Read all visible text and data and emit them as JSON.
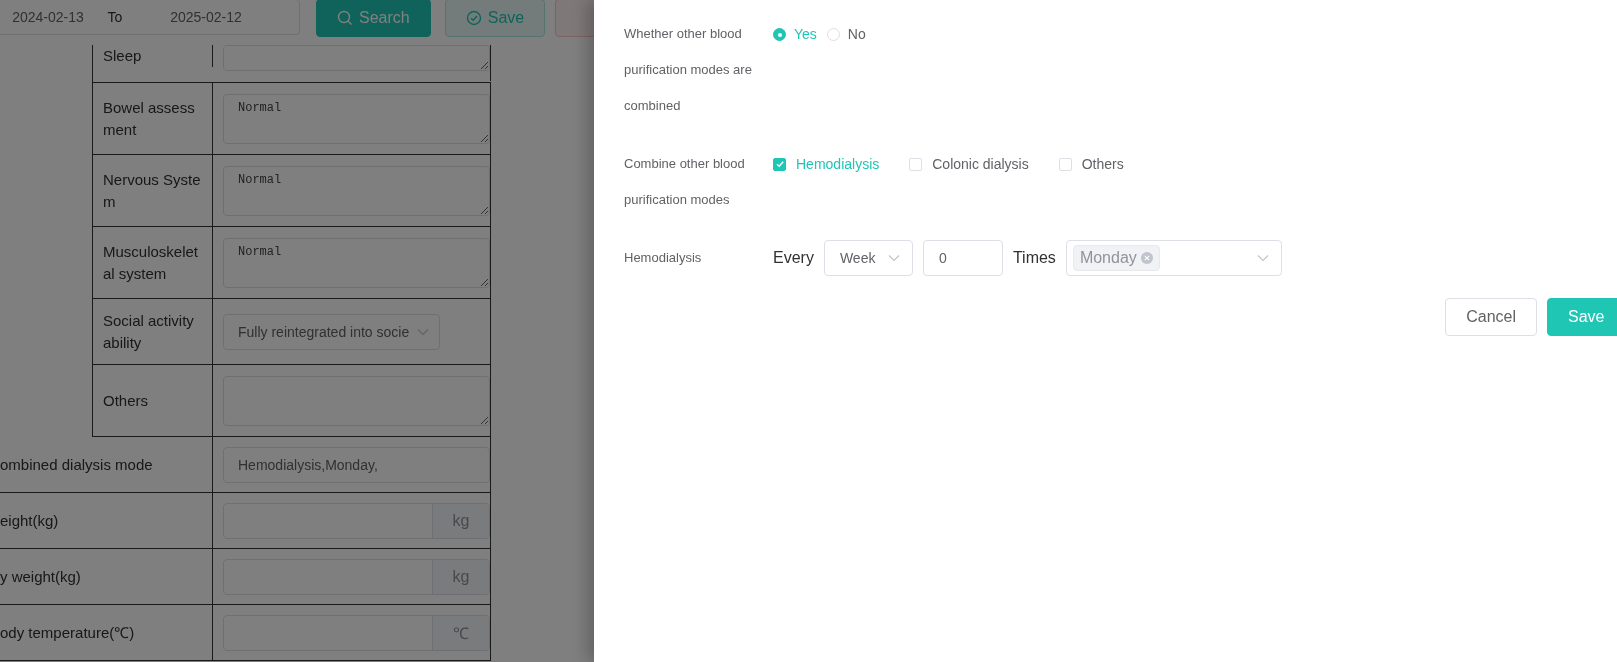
{
  "toolbar": {
    "date_from": "2024-02-13",
    "separator": "To",
    "date_to": "2025-02-12",
    "buttons": [
      {
        "label": "Search",
        "kind": "primary"
      },
      {
        "label": "Save",
        "kind": "success"
      },
      {
        "kind": "danger"
      }
    ]
  },
  "record_table": {
    "grouped_rows": [
      {
        "label": "Sleep",
        "kind": "textarea"
      },
      {
        "label": "Bowel assessment",
        "kind": "textarea",
        "value": "Normal"
      },
      {
        "label": "Nervous System",
        "kind": "textarea",
        "value": "Normal"
      },
      {
        "label": "Musculoskeletal system",
        "kind": "textarea",
        "value": "Normal"
      },
      {
        "label": "Social activity ability",
        "kind": "select",
        "value": "Fully reintegrated into socie"
      },
      {
        "label": "Others",
        "kind": "textarea"
      }
    ],
    "rows": [
      {
        "label": "ombined dialysis mode",
        "kind": "text",
        "value": "Hemodialysis,Monday,"
      },
      {
        "label": "eight(kg)",
        "kind": "unit",
        "unit": "kg"
      },
      {
        "label": "y weight(kg)",
        "kind": "unit",
        "unit": "kg"
      },
      {
        "label": "ody temperature(℃)",
        "kind": "unit",
        "unit": "℃"
      }
    ]
  },
  "drawer": {
    "fields": [
      {
        "kind": "radio",
        "label": "Whether other blood purification modes are combined",
        "options": [
          {
            "label": "Yes",
            "selected": true
          },
          {
            "label": "No",
            "selected": false
          }
        ]
      },
      {
        "kind": "checkbox",
        "label": "Combine other blood purification modes",
        "options": [
          {
            "label": "Hemodialysis",
            "checked": true
          },
          {
            "label": "Colonic dialysis",
            "checked": false
          },
          {
            "label": "Others",
            "checked": false
          }
        ]
      },
      {
        "kind": "schedule",
        "label": "Hemodialysis",
        "every": "Every",
        "period": "Week",
        "count": "0",
        "times": "Times",
        "days": [
          "Monday"
        ]
      }
    ],
    "buttons": [
      {
        "label": "Cancel",
        "kind": "default"
      },
      {
        "label": "Save",
        "kind": "primary"
      }
    ]
  }
}
